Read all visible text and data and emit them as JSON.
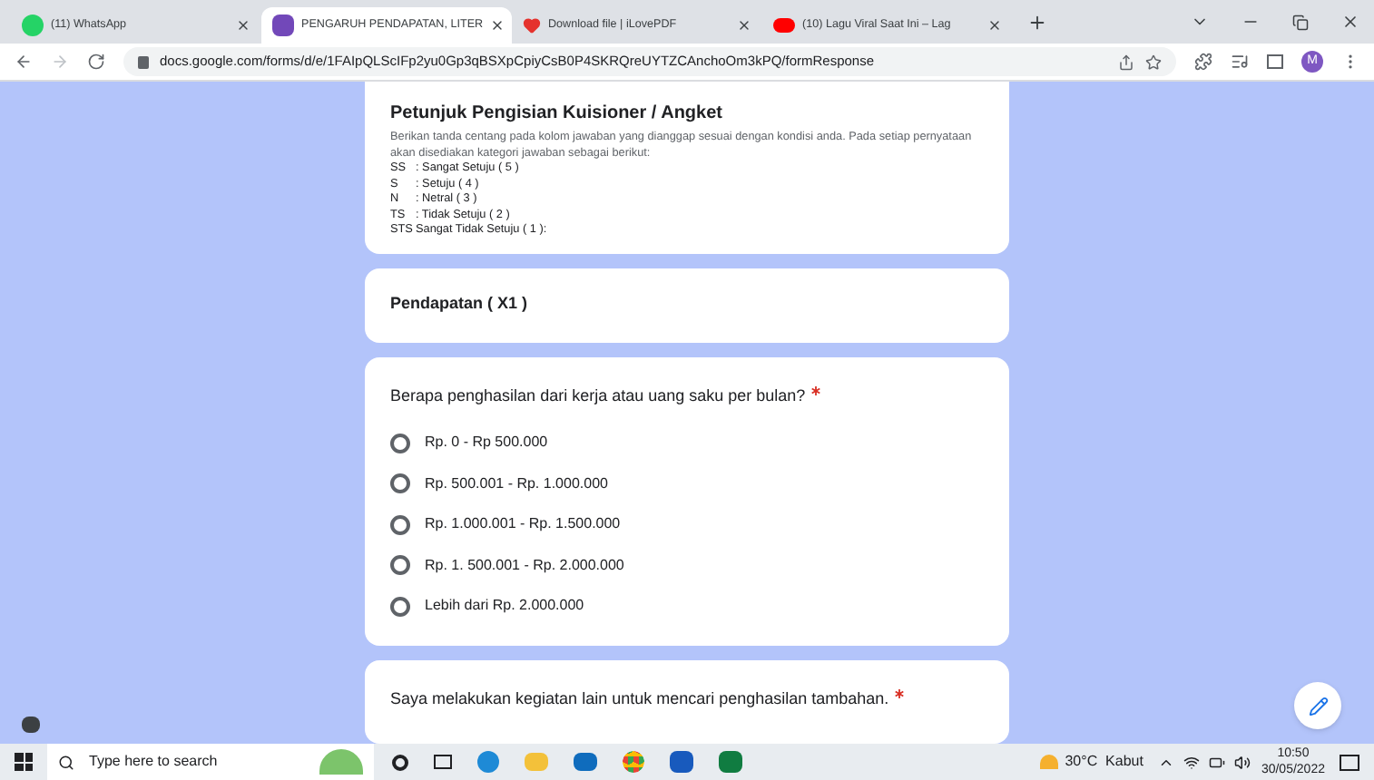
{
  "tabs": [
    {
      "title": "(11) WhatsApp",
      "kind": "whatsapp",
      "selected": false
    },
    {
      "title": "PENGARUH PENDAPATAN, LITER",
      "kind": "forms",
      "selected": true
    },
    {
      "title": "Download file | iLovePDF",
      "kind": "pdf",
      "selected": false
    },
    {
      "title": "(10) Lagu Viral Saat Ini – Lag",
      "kind": "youtube",
      "selected": false
    }
  ],
  "address": "docs.google.com/forms/d/e/1FAIpQLScIFp2yu0Gp3qBSXpCpiyCsB0P4SKRQreUYTZCAnchoOm3kPQ/formResponse",
  "profile": "M",
  "form": {
    "instructions": {
      "title": "Petunjuk Pengisian Kuisioner / Angket",
      "text": "Berikan tanda centang pada kolom jawaban yang dianggap sesuai dengan kondisi anda. Pada setiap pernyataan akan disediakan kategori jawaban sebagai berikut:",
      "scale": [
        {
          "code": "SS",
          "label": ": Sangat Setuju ( 5 )"
        },
        {
          "code": "S",
          "label": ": Setuju ( 4 )"
        },
        {
          "code": "N",
          "label": ": Netral ( 3 )"
        },
        {
          "code": "TS",
          "label": ": Tidak Setuju ( 2 )"
        },
        {
          "code": "STS",
          "label": "Sangat Tidak Setuju ( 1 ):"
        }
      ]
    },
    "section": "Pendapatan ( X1 )",
    "questions": [
      {
        "text": "Berapa penghasilan dari kerja atau uang saku per bulan?",
        "required": true,
        "options": [
          {
            "label": "Rp. 0 - Rp 500.000",
            "selected": false
          },
          {
            "label": "Rp. 500.001 - Rp. 1.000.000",
            "selected": false
          },
          {
            "label": "Rp. 1.000.001 - Rp. 1.500.000",
            "selected": false
          },
          {
            "label": "Rp. 1. 500.001 - Rp. 2.000.000",
            "selected": false
          },
          {
            "label": "Lebih dari Rp. 2.000.000",
            "selected": false
          }
        ]
      },
      {
        "text": "Saya melakukan kegiatan lain untuk mencari penghasilan tambahan.",
        "required": true
      }
    ]
  },
  "taskbar": {
    "search_placeholder": "Type here to search",
    "weather": "30°C  Kabut",
    "time": "10:50",
    "date": "30/05/2022"
  }
}
